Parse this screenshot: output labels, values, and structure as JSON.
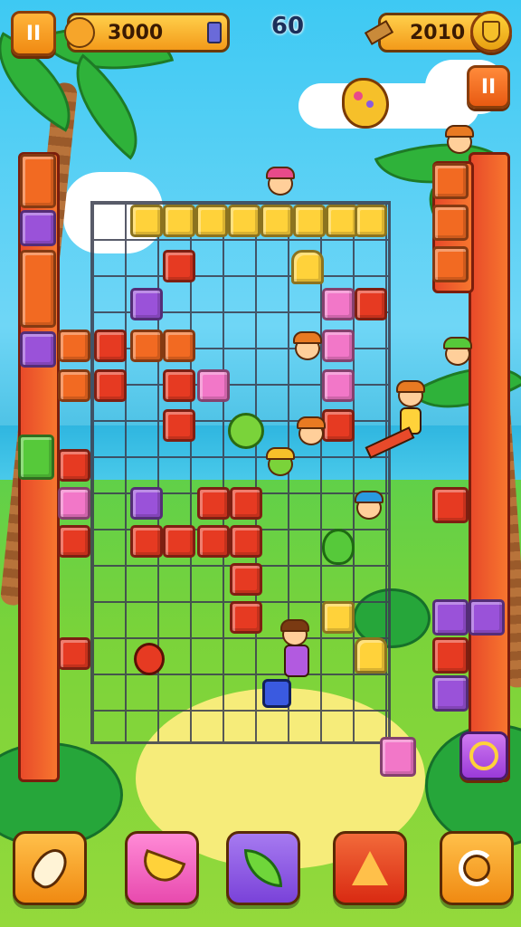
{
  "hud": {
    "coins": "3000",
    "level": "60",
    "score": "2010",
    "pause_label": "II",
    "menu_label": "II"
  },
  "bottom_bar": {
    "powerups": [
      {
        "name": "hammer-powerup",
        "icon": "bone-club-icon",
        "color": "#f6a52a"
      },
      {
        "name": "banana-powerup",
        "icon": "banana-icon",
        "color": "#f277c8"
      },
      {
        "name": "leaf-powerup",
        "icon": "green-leaf-icon",
        "color": "#8a5ae0"
      },
      {
        "name": "drill-powerup",
        "icon": "drill-pyramid-icon",
        "color": "#e63a22"
      },
      {
        "name": "refresh-powerup",
        "icon": "refresh-icon",
        "color": "#f6a52a"
      }
    ]
  },
  "colors": {
    "yellow": "#ffd23a",
    "orange": "#f26a22",
    "red": "#e63a22",
    "purple": "#9a52d9",
    "pink": "#f277c8",
    "green": "#56c93a"
  }
}
